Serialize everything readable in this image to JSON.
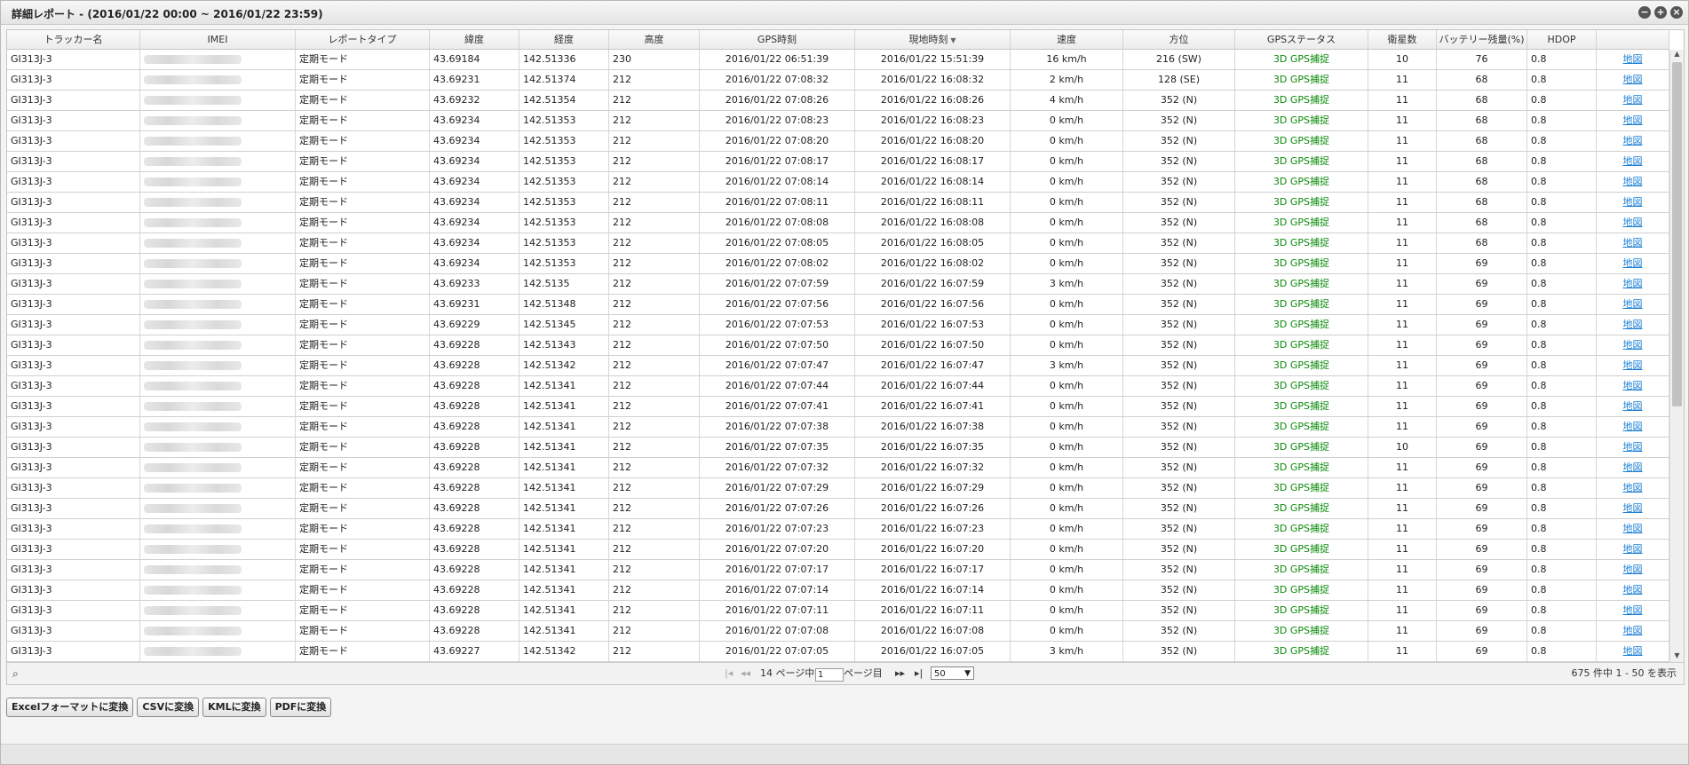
{
  "window": {
    "title": "詳細レポート - (2016/01/22 00:00 ~ 2016/01/22 23:59)",
    "buttons": {
      "minimize": "−",
      "maximize": "+",
      "close": "×"
    }
  },
  "columns": [
    "トラッカー名",
    "IMEI",
    "レポートタイプ",
    "緯度",
    "経度",
    "高度",
    "GPS時刻",
    "現地時刻",
    "速度",
    "方位",
    "GPSステータス",
    "衛星数",
    "バッテリー残量(%)",
    "HDOP",
    ""
  ],
  "sorted_column_icon": "sort-desc-icon",
  "rows": [
    {
      "tracker": "GI313J-3",
      "type": "定期モード",
      "lat": "43.69184",
      "lon": "142.51336",
      "alt": "230",
      "gps_time": "2016/01/22 06:51:39",
      "local_time": "2016/01/22 15:51:39",
      "speed": "16 km/h",
      "bearing": "216 (SW)",
      "status": "3D GPS捕捉",
      "sats": "10",
      "battery": "76",
      "hdop": "0.8",
      "map": "地図"
    },
    {
      "tracker": "GI313J-3",
      "type": "定期モード",
      "lat": "43.69231",
      "lon": "142.51374",
      "alt": "212",
      "gps_time": "2016/01/22 07:08:32",
      "local_time": "2016/01/22 16:08:32",
      "speed": "2 km/h",
      "bearing": "128 (SE)",
      "status": "3D GPS捕捉",
      "sats": "11",
      "battery": "68",
      "hdop": "0.8",
      "map": "地図"
    },
    {
      "tracker": "GI313J-3",
      "type": "定期モード",
      "lat": "43.69232",
      "lon": "142.51354",
      "alt": "212",
      "gps_time": "2016/01/22 07:08:26",
      "local_time": "2016/01/22 16:08:26",
      "speed": "4 km/h",
      "bearing": "352 (N)",
      "status": "3D GPS捕捉",
      "sats": "11",
      "battery": "68",
      "hdop": "0.8",
      "map": "地図"
    },
    {
      "tracker": "GI313J-3",
      "type": "定期モード",
      "lat": "43.69234",
      "lon": "142.51353",
      "alt": "212",
      "gps_time": "2016/01/22 07:08:23",
      "local_time": "2016/01/22 16:08:23",
      "speed": "0 km/h",
      "bearing": "352 (N)",
      "status": "3D GPS捕捉",
      "sats": "11",
      "battery": "68",
      "hdop": "0.8",
      "map": "地図"
    },
    {
      "tracker": "GI313J-3",
      "type": "定期モード",
      "lat": "43.69234",
      "lon": "142.51353",
      "alt": "212",
      "gps_time": "2016/01/22 07:08:20",
      "local_time": "2016/01/22 16:08:20",
      "speed": "0 km/h",
      "bearing": "352 (N)",
      "status": "3D GPS捕捉",
      "sats": "11",
      "battery": "68",
      "hdop": "0.8",
      "map": "地図"
    },
    {
      "tracker": "GI313J-3",
      "type": "定期モード",
      "lat": "43.69234",
      "lon": "142.51353",
      "alt": "212",
      "gps_time": "2016/01/22 07:08:17",
      "local_time": "2016/01/22 16:08:17",
      "speed": "0 km/h",
      "bearing": "352 (N)",
      "status": "3D GPS捕捉",
      "sats": "11",
      "battery": "68",
      "hdop": "0.8",
      "map": "地図"
    },
    {
      "tracker": "GI313J-3",
      "type": "定期モード",
      "lat": "43.69234",
      "lon": "142.51353",
      "alt": "212",
      "gps_time": "2016/01/22 07:08:14",
      "local_time": "2016/01/22 16:08:14",
      "speed": "0 km/h",
      "bearing": "352 (N)",
      "status": "3D GPS捕捉",
      "sats": "11",
      "battery": "68",
      "hdop": "0.8",
      "map": "地図"
    },
    {
      "tracker": "GI313J-3",
      "type": "定期モード",
      "lat": "43.69234",
      "lon": "142.51353",
      "alt": "212",
      "gps_time": "2016/01/22 07:08:11",
      "local_time": "2016/01/22 16:08:11",
      "speed": "0 km/h",
      "bearing": "352 (N)",
      "status": "3D GPS捕捉",
      "sats": "11",
      "battery": "68",
      "hdop": "0.8",
      "map": "地図"
    },
    {
      "tracker": "GI313J-3",
      "type": "定期モード",
      "lat": "43.69234",
      "lon": "142.51353",
      "alt": "212",
      "gps_time": "2016/01/22 07:08:08",
      "local_time": "2016/01/22 16:08:08",
      "speed": "0 km/h",
      "bearing": "352 (N)",
      "status": "3D GPS捕捉",
      "sats": "11",
      "battery": "68",
      "hdop": "0.8",
      "map": "地図"
    },
    {
      "tracker": "GI313J-3",
      "type": "定期モード",
      "lat": "43.69234",
      "lon": "142.51353",
      "alt": "212",
      "gps_time": "2016/01/22 07:08:05",
      "local_time": "2016/01/22 16:08:05",
      "speed": "0 km/h",
      "bearing": "352 (N)",
      "status": "3D GPS捕捉",
      "sats": "11",
      "battery": "68",
      "hdop": "0.8",
      "map": "地図"
    },
    {
      "tracker": "GI313J-3",
      "type": "定期モード",
      "lat": "43.69234",
      "lon": "142.51353",
      "alt": "212",
      "gps_time": "2016/01/22 07:08:02",
      "local_time": "2016/01/22 16:08:02",
      "speed": "0 km/h",
      "bearing": "352 (N)",
      "status": "3D GPS捕捉",
      "sats": "11",
      "battery": "69",
      "hdop": "0.8",
      "map": "地図"
    },
    {
      "tracker": "GI313J-3",
      "type": "定期モード",
      "lat": "43.69233",
      "lon": "142.5135",
      "alt": "212",
      "gps_time": "2016/01/22 07:07:59",
      "local_time": "2016/01/22 16:07:59",
      "speed": "3 km/h",
      "bearing": "352 (N)",
      "status": "3D GPS捕捉",
      "sats": "11",
      "battery": "69",
      "hdop": "0.8",
      "map": "地図"
    },
    {
      "tracker": "GI313J-3",
      "type": "定期モード",
      "lat": "43.69231",
      "lon": "142.51348",
      "alt": "212",
      "gps_time": "2016/01/22 07:07:56",
      "local_time": "2016/01/22 16:07:56",
      "speed": "0 km/h",
      "bearing": "352 (N)",
      "status": "3D GPS捕捉",
      "sats": "11",
      "battery": "69",
      "hdop": "0.8",
      "map": "地図"
    },
    {
      "tracker": "GI313J-3",
      "type": "定期モード",
      "lat": "43.69229",
      "lon": "142.51345",
      "alt": "212",
      "gps_time": "2016/01/22 07:07:53",
      "local_time": "2016/01/22 16:07:53",
      "speed": "0 km/h",
      "bearing": "352 (N)",
      "status": "3D GPS捕捉",
      "sats": "11",
      "battery": "69",
      "hdop": "0.8",
      "map": "地図"
    },
    {
      "tracker": "GI313J-3",
      "type": "定期モード",
      "lat": "43.69228",
      "lon": "142.51343",
      "alt": "212",
      "gps_time": "2016/01/22 07:07:50",
      "local_time": "2016/01/22 16:07:50",
      "speed": "0 km/h",
      "bearing": "352 (N)",
      "status": "3D GPS捕捉",
      "sats": "11",
      "battery": "69",
      "hdop": "0.8",
      "map": "地図"
    },
    {
      "tracker": "GI313J-3",
      "type": "定期モード",
      "lat": "43.69228",
      "lon": "142.51342",
      "alt": "212",
      "gps_time": "2016/01/22 07:07:47",
      "local_time": "2016/01/22 16:07:47",
      "speed": "3 km/h",
      "bearing": "352 (N)",
      "status": "3D GPS捕捉",
      "sats": "11",
      "battery": "69",
      "hdop": "0.8",
      "map": "地図"
    },
    {
      "tracker": "GI313J-3",
      "type": "定期モード",
      "lat": "43.69228",
      "lon": "142.51341",
      "alt": "212",
      "gps_time": "2016/01/22 07:07:44",
      "local_time": "2016/01/22 16:07:44",
      "speed": "0 km/h",
      "bearing": "352 (N)",
      "status": "3D GPS捕捉",
      "sats": "11",
      "battery": "69",
      "hdop": "0.8",
      "map": "地図"
    },
    {
      "tracker": "GI313J-3",
      "type": "定期モード",
      "lat": "43.69228",
      "lon": "142.51341",
      "alt": "212",
      "gps_time": "2016/01/22 07:07:41",
      "local_time": "2016/01/22 16:07:41",
      "speed": "0 km/h",
      "bearing": "352 (N)",
      "status": "3D GPS捕捉",
      "sats": "11",
      "battery": "69",
      "hdop": "0.8",
      "map": "地図"
    },
    {
      "tracker": "GI313J-3",
      "type": "定期モード",
      "lat": "43.69228",
      "lon": "142.51341",
      "alt": "212",
      "gps_time": "2016/01/22 07:07:38",
      "local_time": "2016/01/22 16:07:38",
      "speed": "0 km/h",
      "bearing": "352 (N)",
      "status": "3D GPS捕捉",
      "sats": "11",
      "battery": "69",
      "hdop": "0.8",
      "map": "地図"
    },
    {
      "tracker": "GI313J-3",
      "type": "定期モード",
      "lat": "43.69228",
      "lon": "142.51341",
      "alt": "212",
      "gps_time": "2016/01/22 07:07:35",
      "local_time": "2016/01/22 16:07:35",
      "speed": "0 km/h",
      "bearing": "352 (N)",
      "status": "3D GPS捕捉",
      "sats": "10",
      "battery": "69",
      "hdop": "0.8",
      "map": "地図"
    },
    {
      "tracker": "GI313J-3",
      "type": "定期モード",
      "lat": "43.69228",
      "lon": "142.51341",
      "alt": "212",
      "gps_time": "2016/01/22 07:07:32",
      "local_time": "2016/01/22 16:07:32",
      "speed": "0 km/h",
      "bearing": "352 (N)",
      "status": "3D GPS捕捉",
      "sats": "11",
      "battery": "69",
      "hdop": "0.8",
      "map": "地図"
    },
    {
      "tracker": "GI313J-3",
      "type": "定期モード",
      "lat": "43.69228",
      "lon": "142.51341",
      "alt": "212",
      "gps_time": "2016/01/22 07:07:29",
      "local_time": "2016/01/22 16:07:29",
      "speed": "0 km/h",
      "bearing": "352 (N)",
      "status": "3D GPS捕捉",
      "sats": "11",
      "battery": "69",
      "hdop": "0.8",
      "map": "地図"
    },
    {
      "tracker": "GI313J-3",
      "type": "定期モード",
      "lat": "43.69228",
      "lon": "142.51341",
      "alt": "212",
      "gps_time": "2016/01/22 07:07:26",
      "local_time": "2016/01/22 16:07:26",
      "speed": "0 km/h",
      "bearing": "352 (N)",
      "status": "3D GPS捕捉",
      "sats": "11",
      "battery": "69",
      "hdop": "0.8",
      "map": "地図"
    },
    {
      "tracker": "GI313J-3",
      "type": "定期モード",
      "lat": "43.69228",
      "lon": "142.51341",
      "alt": "212",
      "gps_time": "2016/01/22 07:07:23",
      "local_time": "2016/01/22 16:07:23",
      "speed": "0 km/h",
      "bearing": "352 (N)",
      "status": "3D GPS捕捉",
      "sats": "11",
      "battery": "69",
      "hdop": "0.8",
      "map": "地図"
    },
    {
      "tracker": "GI313J-3",
      "type": "定期モード",
      "lat": "43.69228",
      "lon": "142.51341",
      "alt": "212",
      "gps_time": "2016/01/22 07:07:20",
      "local_time": "2016/01/22 16:07:20",
      "speed": "0 km/h",
      "bearing": "352 (N)",
      "status": "3D GPS捕捉",
      "sats": "11",
      "battery": "69",
      "hdop": "0.8",
      "map": "地図"
    },
    {
      "tracker": "GI313J-3",
      "type": "定期モード",
      "lat": "43.69228",
      "lon": "142.51341",
      "alt": "212",
      "gps_time": "2016/01/22 07:07:17",
      "local_time": "2016/01/22 16:07:17",
      "speed": "0 km/h",
      "bearing": "352 (N)",
      "status": "3D GPS捕捉",
      "sats": "11",
      "battery": "69",
      "hdop": "0.8",
      "map": "地図"
    },
    {
      "tracker": "GI313J-3",
      "type": "定期モード",
      "lat": "43.69228",
      "lon": "142.51341",
      "alt": "212",
      "gps_time": "2016/01/22 07:07:14",
      "local_time": "2016/01/22 16:07:14",
      "speed": "0 km/h",
      "bearing": "352 (N)",
      "status": "3D GPS捕捉",
      "sats": "11",
      "battery": "69",
      "hdop": "0.8",
      "map": "地図"
    },
    {
      "tracker": "GI313J-3",
      "type": "定期モード",
      "lat": "43.69228",
      "lon": "142.51341",
      "alt": "212",
      "gps_time": "2016/01/22 07:07:11",
      "local_time": "2016/01/22 16:07:11",
      "speed": "0 km/h",
      "bearing": "352 (N)",
      "status": "3D GPS捕捉",
      "sats": "11",
      "battery": "69",
      "hdop": "0.8",
      "map": "地図"
    },
    {
      "tracker": "GI313J-3",
      "type": "定期モード",
      "lat": "43.69228",
      "lon": "142.51341",
      "alt": "212",
      "gps_time": "2016/01/22 07:07:08",
      "local_time": "2016/01/22 16:07:08",
      "speed": "0 km/h",
      "bearing": "352 (N)",
      "status": "3D GPS捕捉",
      "sats": "11",
      "battery": "69",
      "hdop": "0.8",
      "map": "地図"
    },
    {
      "tracker": "GI313J-3",
      "type": "定期モード",
      "lat": "43.69227",
      "lon": "142.51342",
      "alt": "212",
      "gps_time": "2016/01/22 07:07:05",
      "local_time": "2016/01/22 16:07:05",
      "speed": "3 km/h",
      "bearing": "352 (N)",
      "status": "3D GPS捕捉",
      "sats": "11",
      "battery": "69",
      "hdop": "0.8",
      "map": "地図"
    }
  ],
  "pager": {
    "search_icon": "magnifier-icon",
    "first_icon": "first-page-icon",
    "prev_icon": "prev-page-icon",
    "next_icon": "next-page-icon",
    "last_icon": "last-page-icon",
    "pages_prefix": "14 ページ中",
    "current_page": "1",
    "pages_suffix": "ページ目",
    "page_size": "50",
    "summary": "675 件中 1 - 50 を表示"
  },
  "actions": {
    "excel": "Excelフォーマットに変換",
    "csv": "CSVに変換",
    "kml": "KMLに変換",
    "pdf": "PDFに変換"
  }
}
